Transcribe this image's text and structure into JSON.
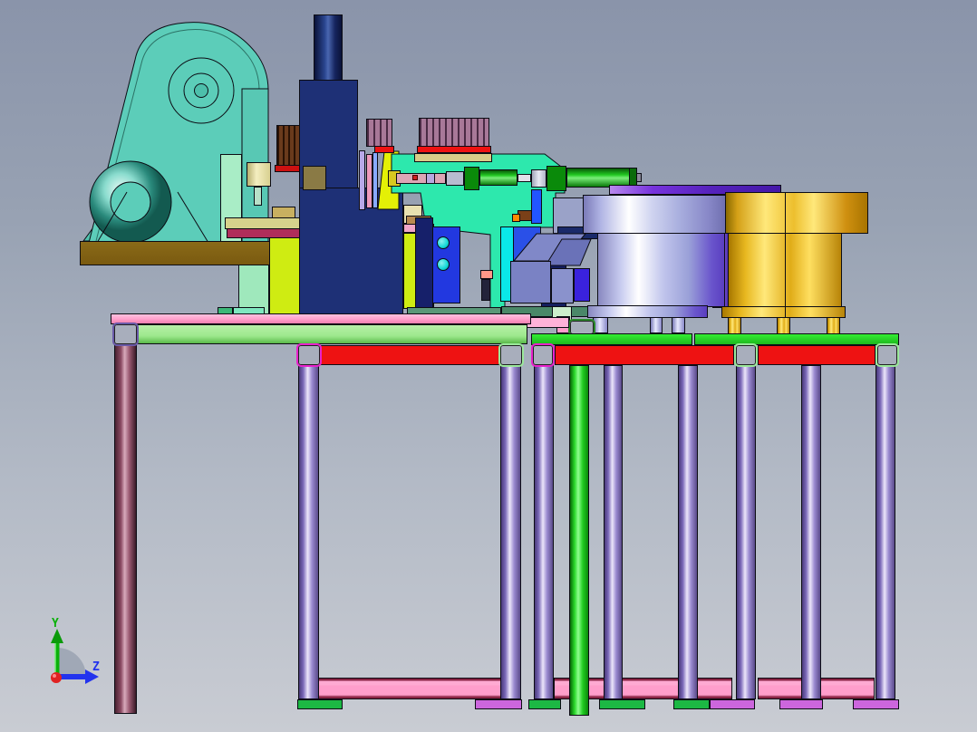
{
  "app": {
    "type": "cad-viewport",
    "description": "3D CAD side elevation of an automated assembly machine: press unit, pneumatic actuators, two vibratory bowl feeders, mounted on welded frame tables"
  },
  "axis_triad": {
    "y_label": "Y",
    "z_label": "Z",
    "y_color": "#0ab00a",
    "z_color": "#2233ee",
    "origin_color": "#e02222"
  },
  "palette": {
    "background_top": "#8a94aa",
    "background_bottom": "#c9ccd3",
    "press_frame": "#5ccdb9",
    "press_base_plate": "#7b5c13",
    "main_column": "#1e3076",
    "heatsink_fins": "#a87898",
    "heatsink_fins_brown": "#6a3a1c",
    "red_strip": "#ee1212",
    "machine_bed_cyan": "#2de8ad",
    "air_cylinder_green": "#22c822",
    "piston_rod_pink": "#dca6b6",
    "guide_panel_blue": "#2238e0",
    "chute_slate": "#7a82c4",
    "bowl_feeder_left": "#c8ccf0",
    "bowl_feeder_right": "#edbf2e",
    "feeder_disc_violet": "#5522bb",
    "table_left_beam": "#9ce88c",
    "table_left_top_pink": "#ff9ecb",
    "table_right_top_green": "#22cc22",
    "cross_beam_red": "#ee1212",
    "leg_purple": "#9a8ad0",
    "leg_mauve": "#8a4a62",
    "leg_green": "#33ee33",
    "bottom_rail_pink": "#ff9ecb",
    "foot_pad_green": "#1cb844",
    "foot_pad_violet": "#cc66dd",
    "bracket_magenta": "#e822cc",
    "bracket_lightgreen": "#9ae89a"
  },
  "components": [
    {
      "id": "press-unit",
      "label": "C-frame press with flywheel",
      "color": "#5ccdb9"
    },
    {
      "id": "press-base-plate",
      "label": "press base plate",
      "color": "#7b5c13"
    },
    {
      "id": "main-column",
      "label": "main ram column with piston",
      "color": "#1e3076"
    },
    {
      "id": "tooling-heatsinks",
      "label": "finned tooling blocks",
      "color": "#a87898"
    },
    {
      "id": "machine-bed",
      "label": "machine bed casting",
      "color": "#2de8ad"
    },
    {
      "id": "air-cylinders",
      "label": "horizontal pneumatic cylinders",
      "color": "#22c822"
    },
    {
      "id": "feed-chute",
      "label": "feed chute blocks",
      "color": "#7a82c4"
    },
    {
      "id": "bowl-feeder-left",
      "label": "vibratory bowl feeder (steel)",
      "color": "#c8ccf0"
    },
    {
      "id": "bowl-feeder-right",
      "label": "vibratory bowl feeder (gold)",
      "color": "#edbf2e"
    },
    {
      "id": "table-left",
      "label": "left machine table",
      "color": "#9ce88c"
    },
    {
      "id": "table-right",
      "label": "right machine table",
      "color": "#22cc22"
    }
  ]
}
